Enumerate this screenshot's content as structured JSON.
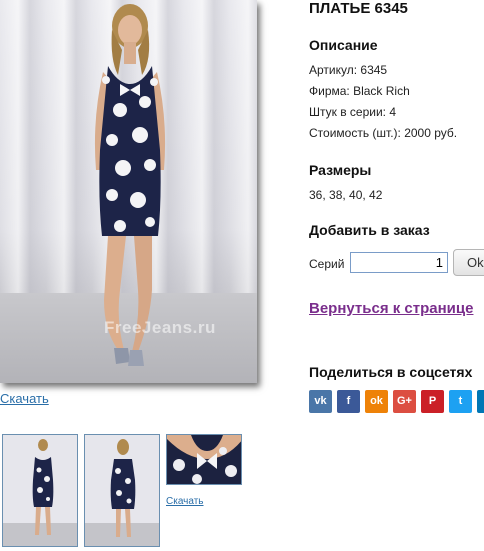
{
  "product": {
    "title": "ПЛАТЬЕ 6345",
    "watermark": "FreeJeans.ru",
    "download_main": "Скачать",
    "download_thumb": "Скачать"
  },
  "description": {
    "heading": "Описание",
    "article": "Артикул: 6345",
    "brand": "Фирма: Black Rich",
    "pieces": "Штук в серии: 4",
    "price": "Стоимость (шт.): 2000 руб."
  },
  "sizes": {
    "heading": "Размеры",
    "values": "36, 38, 40, 42"
  },
  "order": {
    "heading": "Добавить в заказ",
    "qty_label": "Серий",
    "qty_value": "1",
    "ok_label": "Ok"
  },
  "back_link": "Вернуться к странице",
  "share": {
    "heading": "Поделиться в соцсетях",
    "networks": [
      {
        "name": "vk",
        "glyph": "vk",
        "color": "#4a76a8"
      },
      {
        "name": "facebook",
        "glyph": "f",
        "color": "#3b5998"
      },
      {
        "name": "odnoklassniki",
        "glyph": "ok",
        "color": "#ee8208"
      },
      {
        "name": "google-plus",
        "glyph": "G+",
        "color": "#dc4e41"
      },
      {
        "name": "pinterest",
        "glyph": "P",
        "color": "#cb2027"
      },
      {
        "name": "twitter",
        "glyph": "t",
        "color": "#1da1f2"
      },
      {
        "name": "linkedin",
        "glyph": "in",
        "color": "#0077b5"
      }
    ]
  }
}
